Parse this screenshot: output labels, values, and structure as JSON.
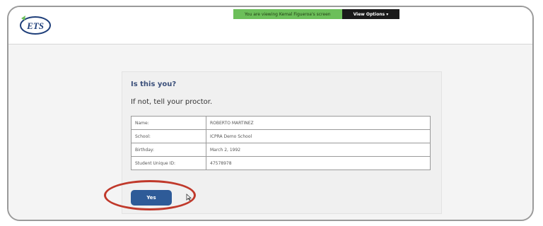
{
  "banner": {
    "screen_share_text": "You are viewing Kemal Figueroa's screen",
    "view_options_label": "View Options ▾"
  },
  "logo": {
    "text": "ETS",
    "accent_color": "#6cbf5a",
    "brand_color": "#1f3f7a"
  },
  "verification": {
    "title": "Is this you?",
    "subtitle": "If not, tell your proctor.",
    "rows": [
      {
        "label": "Name:",
        "value": "ROBERTO MARTINEZ"
      },
      {
        "label": "School:",
        "value": "ICPRA Demo School"
      },
      {
        "label": "Birthday:",
        "value": "March 2, 1992"
      },
      {
        "label": "Student Unique ID:",
        "value": "47578978"
      }
    ],
    "yes_label": "Yes"
  },
  "colors": {
    "button": "#2e5b98",
    "highlight_ring": "#c0392b",
    "title_text": "#3a4f7a"
  }
}
